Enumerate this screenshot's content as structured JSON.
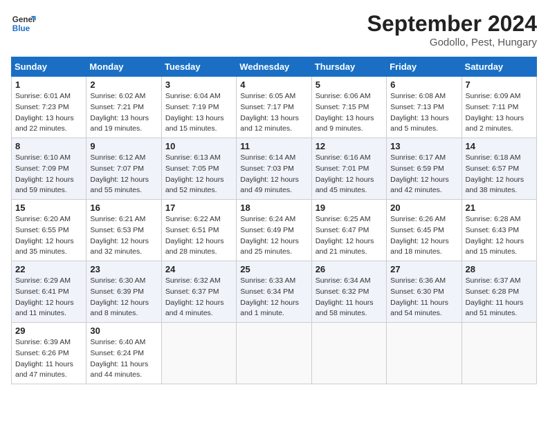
{
  "logo": {
    "line1": "General",
    "line2": "Blue"
  },
  "title": "September 2024",
  "location": "Godollo, Pest, Hungary",
  "days_header": [
    "Sunday",
    "Monday",
    "Tuesday",
    "Wednesday",
    "Thursday",
    "Friday",
    "Saturday"
  ],
  "weeks": [
    [
      {
        "day": "1",
        "sunrise": "6:01 AM",
        "sunset": "7:23 PM",
        "daylight": "13 hours and 22 minutes."
      },
      {
        "day": "2",
        "sunrise": "6:02 AM",
        "sunset": "7:21 PM",
        "daylight": "13 hours and 19 minutes."
      },
      {
        "day": "3",
        "sunrise": "6:04 AM",
        "sunset": "7:19 PM",
        "daylight": "13 hours and 15 minutes."
      },
      {
        "day": "4",
        "sunrise": "6:05 AM",
        "sunset": "7:17 PM",
        "daylight": "13 hours and 12 minutes."
      },
      {
        "day": "5",
        "sunrise": "6:06 AM",
        "sunset": "7:15 PM",
        "daylight": "13 hours and 9 minutes."
      },
      {
        "day": "6",
        "sunrise": "6:08 AM",
        "sunset": "7:13 PM",
        "daylight": "13 hours and 5 minutes."
      },
      {
        "day": "7",
        "sunrise": "6:09 AM",
        "sunset": "7:11 PM",
        "daylight": "13 hours and 2 minutes."
      }
    ],
    [
      {
        "day": "8",
        "sunrise": "6:10 AM",
        "sunset": "7:09 PM",
        "daylight": "12 hours and 59 minutes."
      },
      {
        "day": "9",
        "sunrise": "6:12 AM",
        "sunset": "7:07 PM",
        "daylight": "12 hours and 55 minutes."
      },
      {
        "day": "10",
        "sunrise": "6:13 AM",
        "sunset": "7:05 PM",
        "daylight": "12 hours and 52 minutes."
      },
      {
        "day": "11",
        "sunrise": "6:14 AM",
        "sunset": "7:03 PM",
        "daylight": "12 hours and 49 minutes."
      },
      {
        "day": "12",
        "sunrise": "6:16 AM",
        "sunset": "7:01 PM",
        "daylight": "12 hours and 45 minutes."
      },
      {
        "day": "13",
        "sunrise": "6:17 AM",
        "sunset": "6:59 PM",
        "daylight": "12 hours and 42 minutes."
      },
      {
        "day": "14",
        "sunrise": "6:18 AM",
        "sunset": "6:57 PM",
        "daylight": "12 hours and 38 minutes."
      }
    ],
    [
      {
        "day": "15",
        "sunrise": "6:20 AM",
        "sunset": "6:55 PM",
        "daylight": "12 hours and 35 minutes."
      },
      {
        "day": "16",
        "sunrise": "6:21 AM",
        "sunset": "6:53 PM",
        "daylight": "12 hours and 32 minutes."
      },
      {
        "day": "17",
        "sunrise": "6:22 AM",
        "sunset": "6:51 PM",
        "daylight": "12 hours and 28 minutes."
      },
      {
        "day": "18",
        "sunrise": "6:24 AM",
        "sunset": "6:49 PM",
        "daylight": "12 hours and 25 minutes."
      },
      {
        "day": "19",
        "sunrise": "6:25 AM",
        "sunset": "6:47 PM",
        "daylight": "12 hours and 21 minutes."
      },
      {
        "day": "20",
        "sunrise": "6:26 AM",
        "sunset": "6:45 PM",
        "daylight": "12 hours and 18 minutes."
      },
      {
        "day": "21",
        "sunrise": "6:28 AM",
        "sunset": "6:43 PM",
        "daylight": "12 hours and 15 minutes."
      }
    ],
    [
      {
        "day": "22",
        "sunrise": "6:29 AM",
        "sunset": "6:41 PM",
        "daylight": "12 hours and 11 minutes."
      },
      {
        "day": "23",
        "sunrise": "6:30 AM",
        "sunset": "6:39 PM",
        "daylight": "12 hours and 8 minutes."
      },
      {
        "day": "24",
        "sunrise": "6:32 AM",
        "sunset": "6:37 PM",
        "daylight": "12 hours and 4 minutes."
      },
      {
        "day": "25",
        "sunrise": "6:33 AM",
        "sunset": "6:34 PM",
        "daylight": "12 hours and 1 minute."
      },
      {
        "day": "26",
        "sunrise": "6:34 AM",
        "sunset": "6:32 PM",
        "daylight": "11 hours and 58 minutes."
      },
      {
        "day": "27",
        "sunrise": "6:36 AM",
        "sunset": "6:30 PM",
        "daylight": "11 hours and 54 minutes."
      },
      {
        "day": "28",
        "sunrise": "6:37 AM",
        "sunset": "6:28 PM",
        "daylight": "11 hours and 51 minutes."
      }
    ],
    [
      {
        "day": "29",
        "sunrise": "6:39 AM",
        "sunset": "6:26 PM",
        "daylight": "11 hours and 47 minutes."
      },
      {
        "day": "30",
        "sunrise": "6:40 AM",
        "sunset": "6:24 PM",
        "daylight": "11 hours and 44 minutes."
      },
      null,
      null,
      null,
      null,
      null
    ]
  ]
}
